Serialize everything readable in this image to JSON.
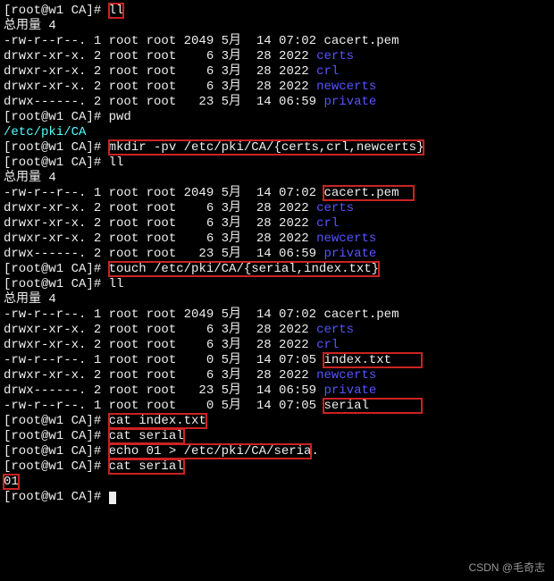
{
  "prompt": "[root@w1 CA]# ",
  "total_label": "总用量 4",
  "cmds": {
    "ll": "ll",
    "pwd": "pwd",
    "pwd_result": "/etc/pki/CA",
    "mkdir": "mkdir -pv /etc/pki/CA/{certs,crl,newcerts}",
    "touch": "touch /etc/pki/CA/{serial,index.txt}",
    "cat_index": "cat index.txt",
    "cat_serial1": "cat serial",
    "echo_serial": "echo 01 > /etc/pki/CA/seria",
    "echo_dot": ".",
    "cat_serial2": "cat serial",
    "serial_out": "01"
  },
  "lists": {
    "a": [
      {
        "perm": "-rw-r--r--. 1 root root 2049 5月  14 07:02 ",
        "name": "cacert.pem",
        "cls": "w"
      },
      {
        "perm": "drwxr-xr-x. 2 root root    6 3月  28 2022 ",
        "name": "certs",
        "cls": "bl"
      },
      {
        "perm": "drwxr-xr-x. 2 root root    6 3月  28 2022 ",
        "name": "crl",
        "cls": "bl"
      },
      {
        "perm": "drwxr-xr-x. 2 root root    6 3月  28 2022 ",
        "name": "newcerts",
        "cls": "bl"
      },
      {
        "perm": "drwx------. 2 root root   23 5月  14 06:59 ",
        "name": "private",
        "cls": "bl"
      }
    ],
    "b": [
      {
        "perm": "-rw-r--r--. 1 root root 2049 5月  14 07:02 ",
        "name": "cacert.pem",
        "cls": "w",
        "rb": true,
        "pad": "  "
      },
      {
        "perm": "drwxr-xr-x. 2 root root    6 3月  28 2022 ",
        "name": "certs",
        "cls": "bl"
      },
      {
        "perm": "drwxr-xr-x. 2 root root    6 3月  28 2022 ",
        "name": "crl",
        "cls": "bl"
      },
      {
        "perm": "drwxr-xr-x. 2 root root    6 3月  28 2022 ",
        "name": "newcerts",
        "cls": "bl"
      },
      {
        "perm": "drwx------. 2 root root   23 5月  14 06:59 ",
        "name": "private",
        "cls": "bl"
      }
    ],
    "c": [
      {
        "perm": "-rw-r--r--. 1 root root 2049 5月  14 07:02 ",
        "name": "cacert.pem",
        "cls": "w"
      },
      {
        "perm": "drwxr-xr-x. 2 root root    6 3月  28 2022 ",
        "name": "certs",
        "cls": "bl"
      },
      {
        "perm": "drwxr-xr-x. 2 root root    6 3月  28 2022 ",
        "name": "crl",
        "cls": "bl"
      },
      {
        "perm": "-rw-r--r--. 1 root root    0 5月  14 07:05 ",
        "name": "index.txt",
        "cls": "w",
        "rb": true,
        "pad": "    "
      },
      {
        "perm": "drwxr-xr-x. 2 root root    6 3月  28 2022 ",
        "name": "newcerts",
        "cls": "bl"
      },
      {
        "perm": "drwx------. 2 root root   23 5月  14 06:59 ",
        "name": "private",
        "cls": "bl"
      },
      {
        "perm": "-rw-r--r--. 1 root root    0 5月  14 07:05 ",
        "name": "serial",
        "cls": "w",
        "rb": true,
        "pad": "       "
      }
    ]
  },
  "watermark": "CSDN @毛奇志"
}
